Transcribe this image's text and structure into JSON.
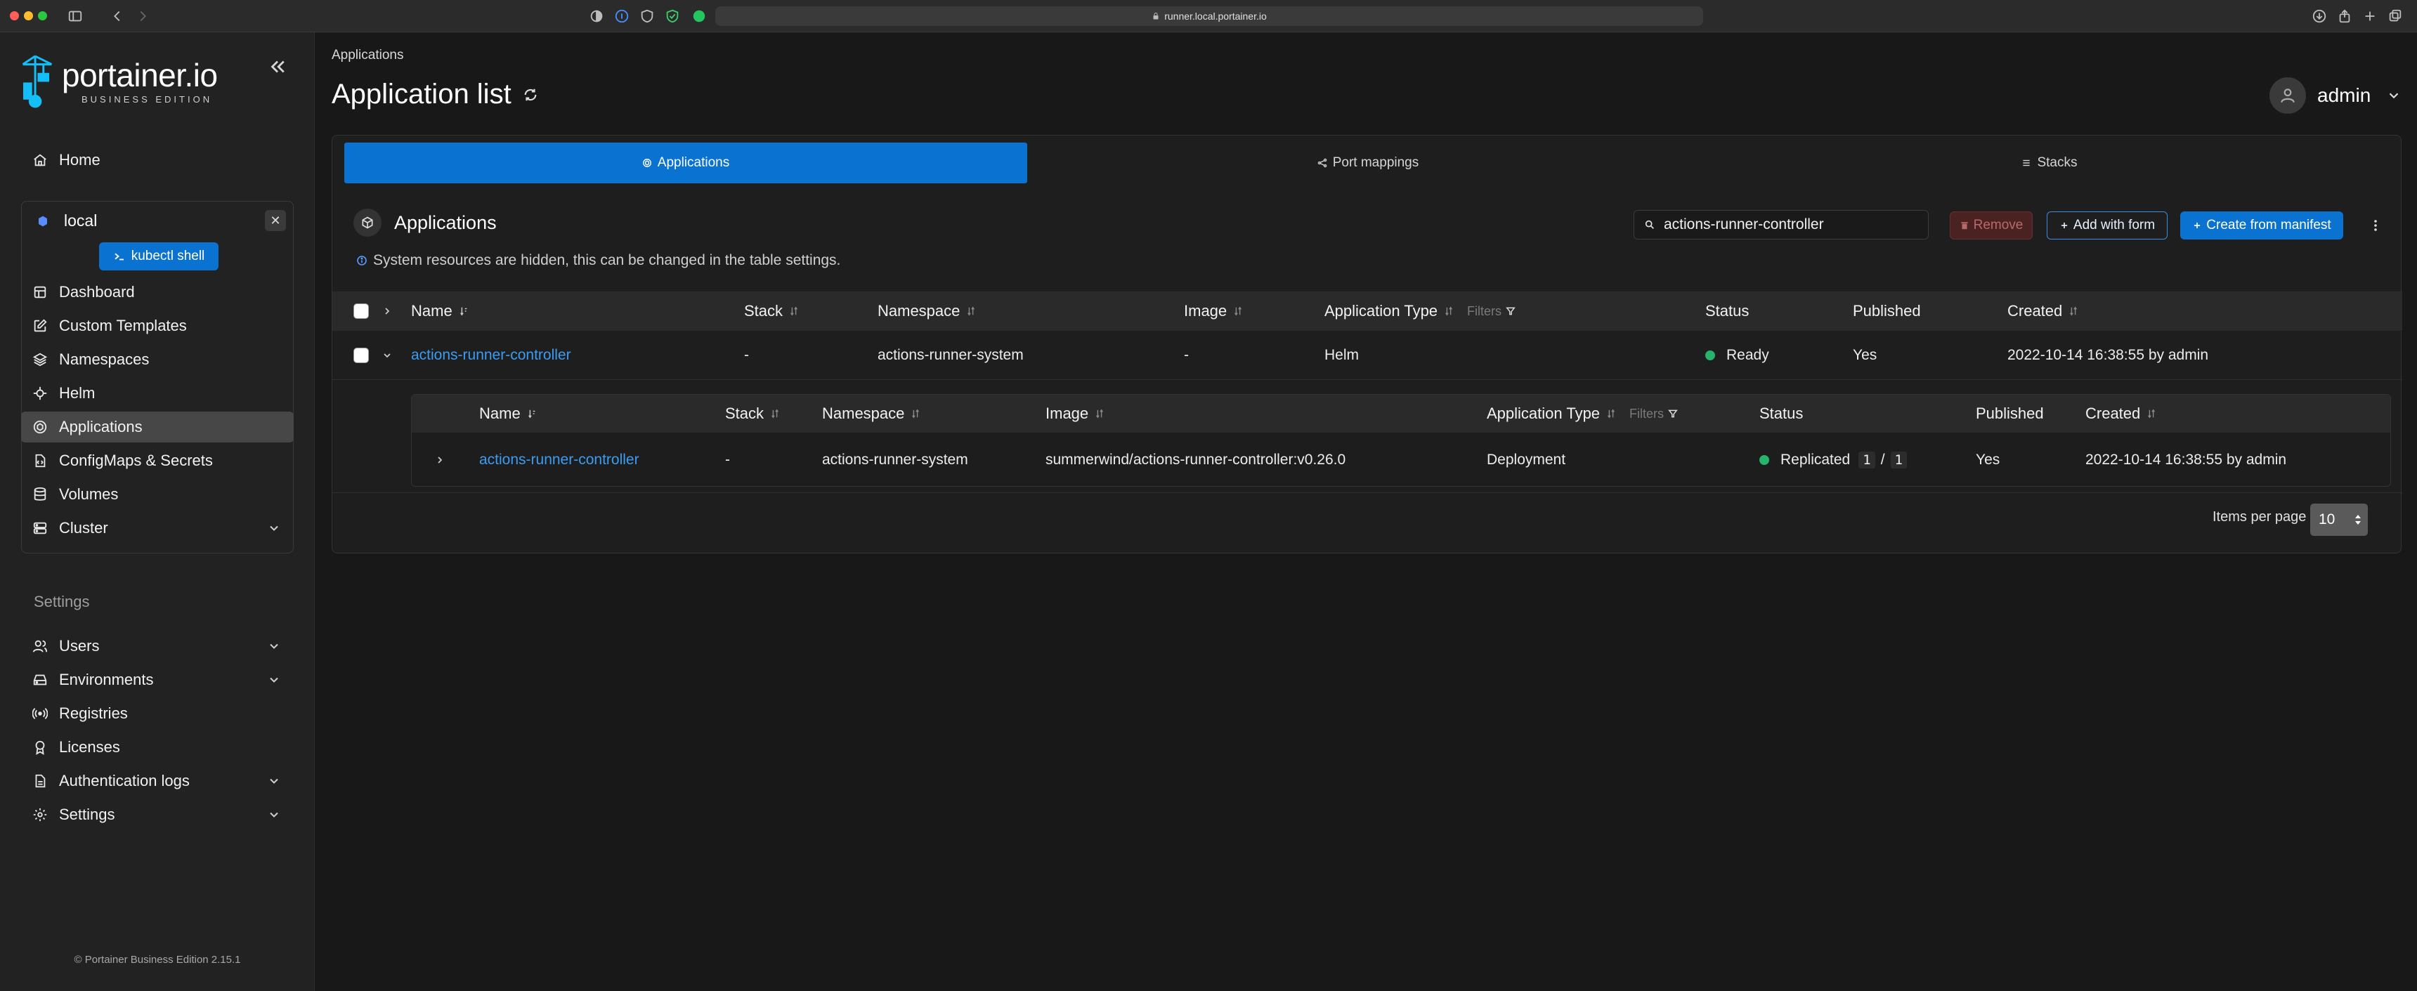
{
  "browser": {
    "url": "runner.local.portainer.io"
  },
  "sidebar": {
    "logo_text": "portainer.io",
    "logo_sub": "BUSINESS EDITION",
    "home": "Home",
    "environment": {
      "name": "local",
      "kubectl_label": "kubectl shell"
    },
    "env_items": [
      {
        "label": "Dashboard",
        "icon": "dashboard-icon"
      },
      {
        "label": "Custom Templates",
        "icon": "edit-icon"
      },
      {
        "label": "Namespaces",
        "icon": "layers-icon"
      },
      {
        "label": "Helm",
        "icon": "helm-icon"
      },
      {
        "label": "Applications",
        "icon": "box-icon"
      },
      {
        "label": "ConfigMaps & Secrets",
        "icon": "file-code-icon"
      },
      {
        "label": "Volumes",
        "icon": "database-icon"
      },
      {
        "label": "Cluster",
        "icon": "server-icon"
      }
    ],
    "settings_heading": "Settings",
    "settings_items": [
      {
        "label": "Users",
        "icon": "users-icon"
      },
      {
        "label": "Environments",
        "icon": "hdd-icon"
      },
      {
        "label": "Registries",
        "icon": "radio-icon"
      },
      {
        "label": "Licenses",
        "icon": "award-icon"
      },
      {
        "label": "Authentication logs",
        "icon": "file-text-icon"
      },
      {
        "label": "Settings",
        "icon": "gear-icon"
      }
    ],
    "footer": "© Portainer Business Edition 2.15.1"
  },
  "header": {
    "breadcrumb": "Applications",
    "title": "Application list",
    "username": "admin"
  },
  "tabs": [
    {
      "label": "Applications"
    },
    {
      "label": "Port mappings"
    },
    {
      "label": "Stacks"
    }
  ],
  "applications": {
    "title": "Applications",
    "info": "System resources are hidden, this can be changed in the table settings.",
    "search_value": "actions-runner-controller",
    "buttons": {
      "remove": "Remove",
      "add_form": "Add with form",
      "create_manifest": "Create from manifest"
    },
    "columns": {
      "name": "Name",
      "stack": "Stack",
      "namespace": "Namespace",
      "image": "Image",
      "app_type": "Application Type",
      "filters": "Filters",
      "status": "Status",
      "published": "Published",
      "created": "Created"
    },
    "row": {
      "name": "actions-runner-controller",
      "stack": "-",
      "namespace": "actions-runner-system",
      "image": "-",
      "app_type": "Helm",
      "status": "Ready",
      "published": "Yes",
      "created": "2022-10-14 16:38:55 by admin"
    },
    "sub_row": {
      "name": "actions-runner-controller",
      "stack": "-",
      "namespace": "actions-runner-system",
      "image": "summerwind/actions-runner-controller:v0.26.0",
      "app_type": "Deployment",
      "status": "Replicated",
      "replicas_ready": "1",
      "replicas_sep": "/",
      "replicas_total": "1",
      "published": "Yes",
      "created": "2022-10-14 16:38:55 by admin"
    },
    "pager": {
      "label": "Items per page",
      "value": "10"
    }
  },
  "colors": {
    "accent": "#0a73d1",
    "link": "#3b9cf2",
    "status_ok": "#26b36b"
  }
}
